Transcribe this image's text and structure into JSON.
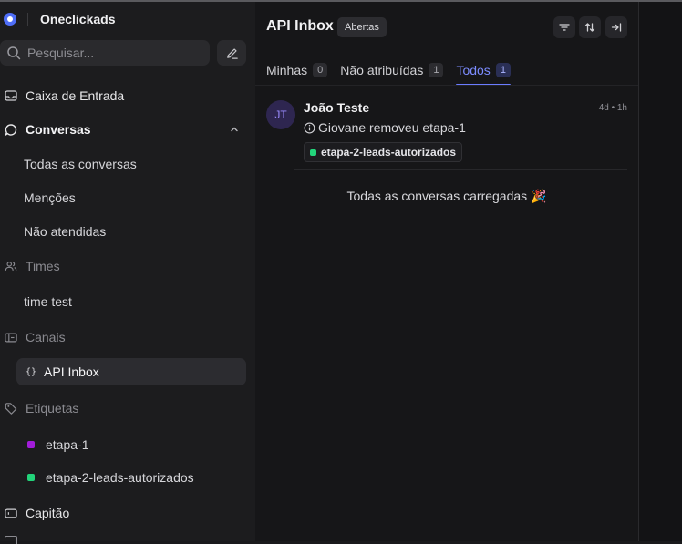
{
  "app": {
    "name": "Oneclickads"
  },
  "sidebar": {
    "search_placeholder": "Pesquisar...",
    "inbox_label": "Caixa de Entrada",
    "conversations_label": "Conversas",
    "conversation_items": [
      "Todas as conversas",
      "Menções",
      "Não atendidas"
    ],
    "teams_label": "Times",
    "team_items": [
      "time test"
    ],
    "channels_label": "Canais",
    "channel_items": [
      "API Inbox"
    ],
    "labels_label": "Etiquetas",
    "label_items": [
      {
        "name": "etapa-1",
        "color": "#a21cd9"
      },
      {
        "name": "etapa-2-leads-autorizados",
        "color": "#22d47a"
      }
    ],
    "captain_label": "Capitão"
  },
  "main": {
    "title": "API Inbox",
    "status_badge": "Abertas",
    "tabs": [
      {
        "label": "Minhas",
        "count": "0"
      },
      {
        "label": "Não atribuídas",
        "count": "1"
      },
      {
        "label": "Todos",
        "count": "1"
      }
    ],
    "conversation": {
      "initials": "JT",
      "name": "João Teste",
      "time": "4d • 1h",
      "message": "Giovane removeu etapa-1",
      "tag": "etapa-2-leads-autorizados"
    },
    "all_loaded": "Todas as conversas carregadas 🎉"
  },
  "colors": {
    "accent": "#6b7cff",
    "background": "#1a1a1c"
  }
}
